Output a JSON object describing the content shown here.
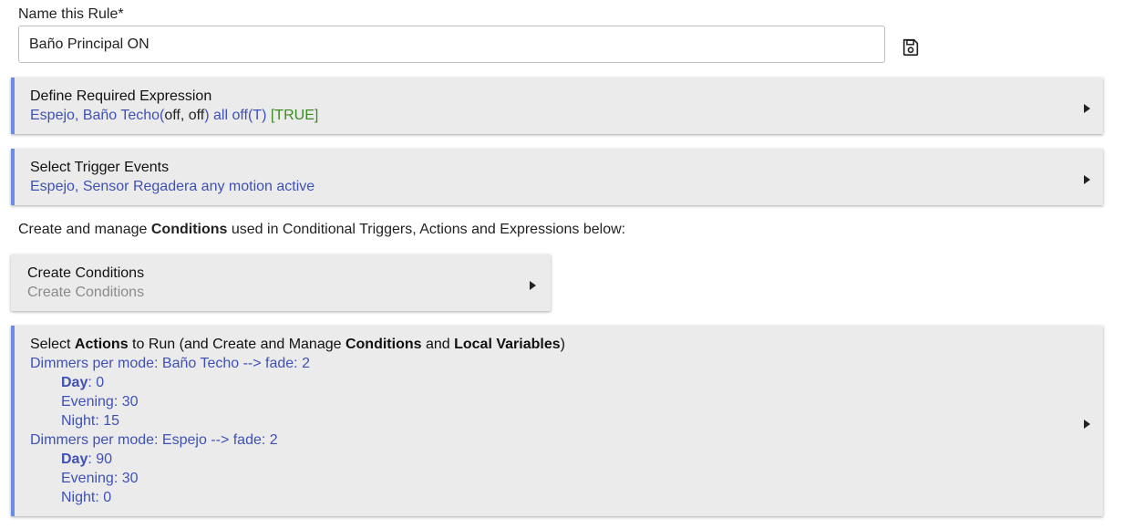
{
  "rule_name": {
    "label": "Name this Rule*",
    "value": "Baño Principal ON"
  },
  "icons": {
    "save": "floppy-disk-icon",
    "expand": "triangle-right-icon"
  },
  "colors": {
    "accent": "#6b8de3",
    "link_text": "#3f51b5",
    "true_text": "#3c8a22",
    "card_bg": "#ebebeb"
  },
  "required_expression": {
    "title": "Define Required Expression",
    "devices": "Espejo, Baño Techo",
    "open_paren": "(",
    "states": "off, off",
    "rest": ") all off(T)",
    "result": "[TRUE]"
  },
  "trigger_events": {
    "title": "Select Trigger Events",
    "summary": "Espejo, Sensor Regadera any motion active"
  },
  "conditions_info": {
    "before": "Create and manage ",
    "bold": "Conditions",
    "after": " used in Conditional Triggers, Actions and Expressions below:"
  },
  "create_conditions": {
    "title": "Create Conditions",
    "subtitle": "Create Conditions"
  },
  "actions": {
    "title_parts": {
      "p1": "Select ",
      "b1": "Actions",
      "p2": " to Run (and Create and Manage ",
      "b2": "Conditions",
      "p3": " and ",
      "b3": "Local Variables",
      "p4": ")"
    },
    "groups": [
      {
        "header": "Dimmers per mode: Baño Techo --> fade: 2",
        "modes": [
          {
            "mode": "Day",
            "sep": ": ",
            "value": "0"
          },
          {
            "mode": "Evening",
            "sep": ": ",
            "value": "30"
          },
          {
            "mode": "Night",
            "sep": ": ",
            "value": "15"
          }
        ]
      },
      {
        "header": "Dimmers per mode: Espejo --> fade: 2",
        "modes": [
          {
            "mode": "Day",
            "sep": ": ",
            "value": "90"
          },
          {
            "mode": "Evening",
            "sep": ": ",
            "value": "30"
          },
          {
            "mode": "Night",
            "sep": ": ",
            "value": "0"
          }
        ]
      }
    ]
  }
}
